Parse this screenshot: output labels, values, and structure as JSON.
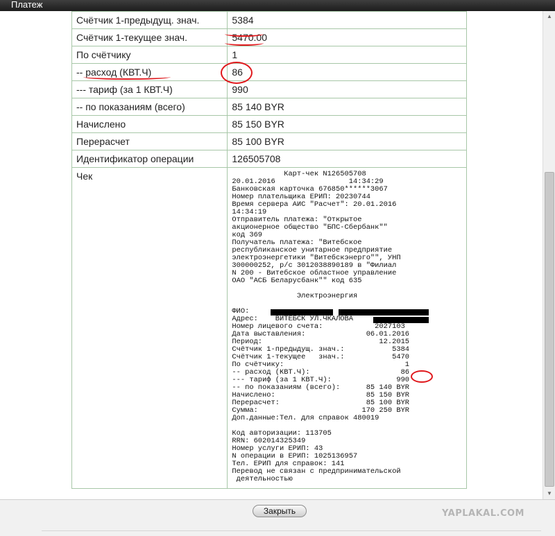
{
  "window": {
    "title": "Платеж"
  },
  "rows": [
    {
      "label": "Счётчик 1-предыдущ. знач.",
      "value": "5384"
    },
    {
      "label": "Счётчик 1-текущее знач.",
      "value": "5470.00"
    },
    {
      "label": "По счётчику",
      "value": "1"
    },
    {
      "label": "-- расход (КВТ.Ч)",
      "value": "86"
    },
    {
      "label": "--- тариф (за 1 КВТ.Ч)",
      "value": "990"
    },
    {
      "label": "-- по показаниям (всего)",
      "value": "85 140 BYR"
    },
    {
      "label": "Начислено",
      "value": "85 150 BYR"
    },
    {
      "label": "Перерасчет",
      "value": "85 100 BYR"
    },
    {
      "label": "Идентификатор операции",
      "value": "126505708"
    }
  ],
  "receipt_label": "Чек",
  "receipt_lines": [
    "            Карт-чек N126505708",
    "20.01.2016                 14:34:29",
    "Банковская карточка 676850******3067",
    "Номер плательщика ЕРИП: 20230744",
    "Время сервера АИС \"Расчет\": 20.01.2016",
    "14:34:19",
    "Отправитель платежа: \"Открытое",
    "акционерное общество \"БПС-Сбербанк\"\"",
    "код 369",
    "Получатель платежа: \"Витебское",
    "республиканское унитарное предприятие",
    "электроэнергетики \"Витебскэнерго\"\", УНП",
    "300000252, р/с 3012038890189 в \"Филиал",
    "N 200 - Витебское областное управление",
    "ОАО \"АСБ Беларусбанк\"\" код 635",
    "",
    "               Электроэнергия",
    "",
    "ФИО:",
    "Адрес:    ВИТЕБСК УЛ.ЧКАЛОВА",
    "Номер лицевого счета:            2027103",
    "Дата выставления:              06.01.2016",
    "Период:                           12.2015",
    "Счётчик 1-предыдущ. знач.:           5384",
    "Счётчик 1-текущее   знач.:           5470",
    "По счётчику:                            1",
    "-- расход (КВТ.Ч):                     86",
    "--- тариф (за 1 КВТ.Ч):               990",
    "-- по показаниям (всего):      85 140 BYR",
    "Начислено:                     85 150 BYR",
    "Перерасчет:                    85 100 BYR",
    "Сумма:                        170 250 BYR",
    "Доп.данные:Тел. для справок 480019",
    "",
    "Код авторизации: 113705",
    "RRN: 602014325349",
    "Номер услуги ЕРИП: 43",
    "N операции в ЕРИП: 1025136957",
    "Тел. ЕРИП для справок: 141",
    "Перевод не связан с предпринимательской",
    " деятельностью"
  ],
  "footer": {
    "close_label": "Закрыть",
    "watermark": "YAPLAKAL.COM"
  },
  "colors": {
    "annotation_red": "#e0191d",
    "table_border": "#a7c7a7"
  }
}
